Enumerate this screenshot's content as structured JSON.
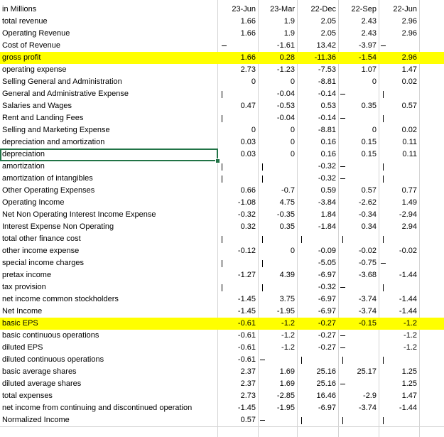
{
  "columns": [
    "23-Jun",
    "23-Mar",
    "22-Dec",
    "22-Sep",
    "22-Jun"
  ],
  "header_label": "in Millions",
  "rows": [
    {
      "label": "total revenue",
      "values": [
        "1.66",
        "1.9",
        "2.05",
        "2.43",
        "2.96"
      ]
    },
    {
      "label": "Operating Revenue",
      "values": [
        "1.66",
        "1.9",
        "2.05",
        "2.43",
        "2.96"
      ]
    },
    {
      "label": "Cost of Revenue",
      "values": [
        "",
        "-1.61",
        "13.42",
        "-3.97",
        ""
      ],
      "marks": [
        "dash",
        "",
        "",
        "",
        "dash-left"
      ]
    },
    {
      "label": "gross profit",
      "values": [
        "1.66",
        "0.28",
        "-11.36",
        "-1.54",
        "2.96"
      ],
      "highlight": true
    },
    {
      "label": "operating expense",
      "values": [
        "2.73",
        "-1.23",
        "-7.53",
        "1.07",
        "1.47"
      ]
    },
    {
      "label": "Selling General and Administration",
      "values": [
        "0",
        "0",
        "-8.81",
        "0",
        "0.02"
      ]
    },
    {
      "label": "General and Administrative Expense",
      "values": [
        "",
        "-0.04",
        "-0.14",
        "",
        ""
      ],
      "marks": [
        "bar",
        "",
        "",
        "dash-left",
        "bar"
      ]
    },
    {
      "label": "Salaries and Wages",
      "values": [
        "0.47",
        "-0.53",
        "0.53",
        "0.35",
        "0.57"
      ]
    },
    {
      "label": "Rent and Landing Fees",
      "values": [
        "",
        "-0.04",
        "-0.14",
        "",
        ""
      ],
      "marks": [
        "bar",
        "",
        "",
        "dash-left",
        "bar"
      ]
    },
    {
      "label": "Selling and Marketing Expense",
      "values": [
        "0",
        "0",
        "-8.81",
        "0",
        "0.02"
      ]
    },
    {
      "label": "depreciation and amortization",
      "values": [
        "0.03",
        "0",
        "0.16",
        "0.15",
        "0.11"
      ]
    },
    {
      "label": "depreciation",
      "values": [
        "0.03",
        "0",
        "0.16",
        "0.15",
        "0.11"
      ]
    },
    {
      "label": "amortization",
      "values": [
        "",
        "",
        "-0.32",
        "",
        ""
      ],
      "marks": [
        "bar",
        "bar",
        "",
        "dash-left",
        "bar"
      ]
    },
    {
      "label": "amortization of intangibles",
      "values": [
        "",
        "",
        "-0.32",
        "",
        ""
      ],
      "marks": [
        "bar",
        "bar",
        "",
        "dash-left",
        "bar"
      ]
    },
    {
      "label": "Other Operating Expenses",
      "values": [
        "0.66",
        "-0.7",
        "0.59",
        "0.57",
        "0.77"
      ]
    },
    {
      "label": "Operating Income",
      "values": [
        "-1.08",
        "4.75",
        "-3.84",
        "-2.62",
        "1.49"
      ]
    },
    {
      "label": "Net Non Operating Interest Income Expense",
      "values": [
        "-0.32",
        "-0.35",
        "1.84",
        "-0.34",
        "-2.94"
      ]
    },
    {
      "label": "Interest Expense Non Operating",
      "values": [
        "0.32",
        "0.35",
        "-1.84",
        "0.34",
        "2.94"
      ]
    },
    {
      "label": "total other finance cost",
      "values": [
        "",
        "",
        "",
        "",
        ""
      ],
      "marks": [
        "bar",
        "bar",
        "bar",
        "bar",
        "bar"
      ]
    },
    {
      "label": "other income expense",
      "values": [
        "-0.12",
        "0",
        "-0.09",
        "-0.02",
        "-0.02"
      ]
    },
    {
      "label": "special income charges",
      "values": [
        "",
        "",
        "-5.05",
        "-0.75",
        ""
      ],
      "marks": [
        "bar",
        "bar",
        "",
        "",
        "dash-left"
      ]
    },
    {
      "label": "pretax income",
      "values": [
        "-1.27",
        "4.39",
        "-6.97",
        "-3.68",
        "-1.44"
      ]
    },
    {
      "label": "tax provision",
      "values": [
        "",
        "",
        "-0.32",
        "",
        ""
      ],
      "marks": [
        "bar",
        "bar",
        "",
        "dash-left",
        "bar"
      ]
    },
    {
      "label": "net income common stockholders",
      "values": [
        "-1.45",
        "3.75",
        "-6.97",
        "-3.74",
        "-1.44"
      ]
    },
    {
      "label": "Net Income",
      "values": [
        "-1.45",
        "-1.95",
        "-6.97",
        "-3.74",
        "-1.44"
      ]
    },
    {
      "label": "basic EPS",
      "values": [
        "-0.61",
        "-1.2",
        "-0.27",
        "-0.15",
        "-1.2"
      ],
      "highlight": true
    },
    {
      "label": "basic continuous operations",
      "values": [
        "-0.61",
        "-1.2",
        "-0.27",
        "",
        "-1.2"
      ],
      "marks": [
        "",
        "",
        "",
        "dash-left",
        ""
      ]
    },
    {
      "label": "diluted EPS",
      "values": [
        "-0.61",
        "-1.2",
        "-0.27",
        "",
        "-1.2"
      ],
      "marks": [
        "",
        "",
        "",
        "dash-left",
        ""
      ]
    },
    {
      "label": "diluted continuous operations",
      "values": [
        "-0.61",
        "",
        "",
        "",
        ""
      ],
      "marks": [
        "",
        "dash-left",
        "bar",
        "bar",
        "bar"
      ]
    },
    {
      "label": "basic average shares",
      "values": [
        "2.37",
        "1.69",
        "25.16",
        "25.17",
        "1.25"
      ]
    },
    {
      "label": "diluted average shares",
      "values": [
        "2.37",
        "1.69",
        "25.16",
        "",
        "1.25"
      ],
      "marks": [
        "",
        "",
        "",
        "dash-left",
        ""
      ]
    },
    {
      "label": "total expenses",
      "values": [
        "2.73",
        "-2.85",
        "16.46",
        "-2.9",
        "1.47"
      ]
    },
    {
      "label": "net income from continuing and discontinued operation",
      "values": [
        "-1.45",
        "-1.95",
        "-6.97",
        "-3.74",
        "-1.44"
      ]
    },
    {
      "label": "Normalized Income",
      "values": [
        "0.57",
        "",
        "",
        "",
        ""
      ],
      "marks": [
        "",
        "dash-left",
        "bar",
        "bar",
        "bar"
      ]
    }
  ],
  "selected_cell": {
    "row_label": "depreciation",
    "column": "label"
  }
}
